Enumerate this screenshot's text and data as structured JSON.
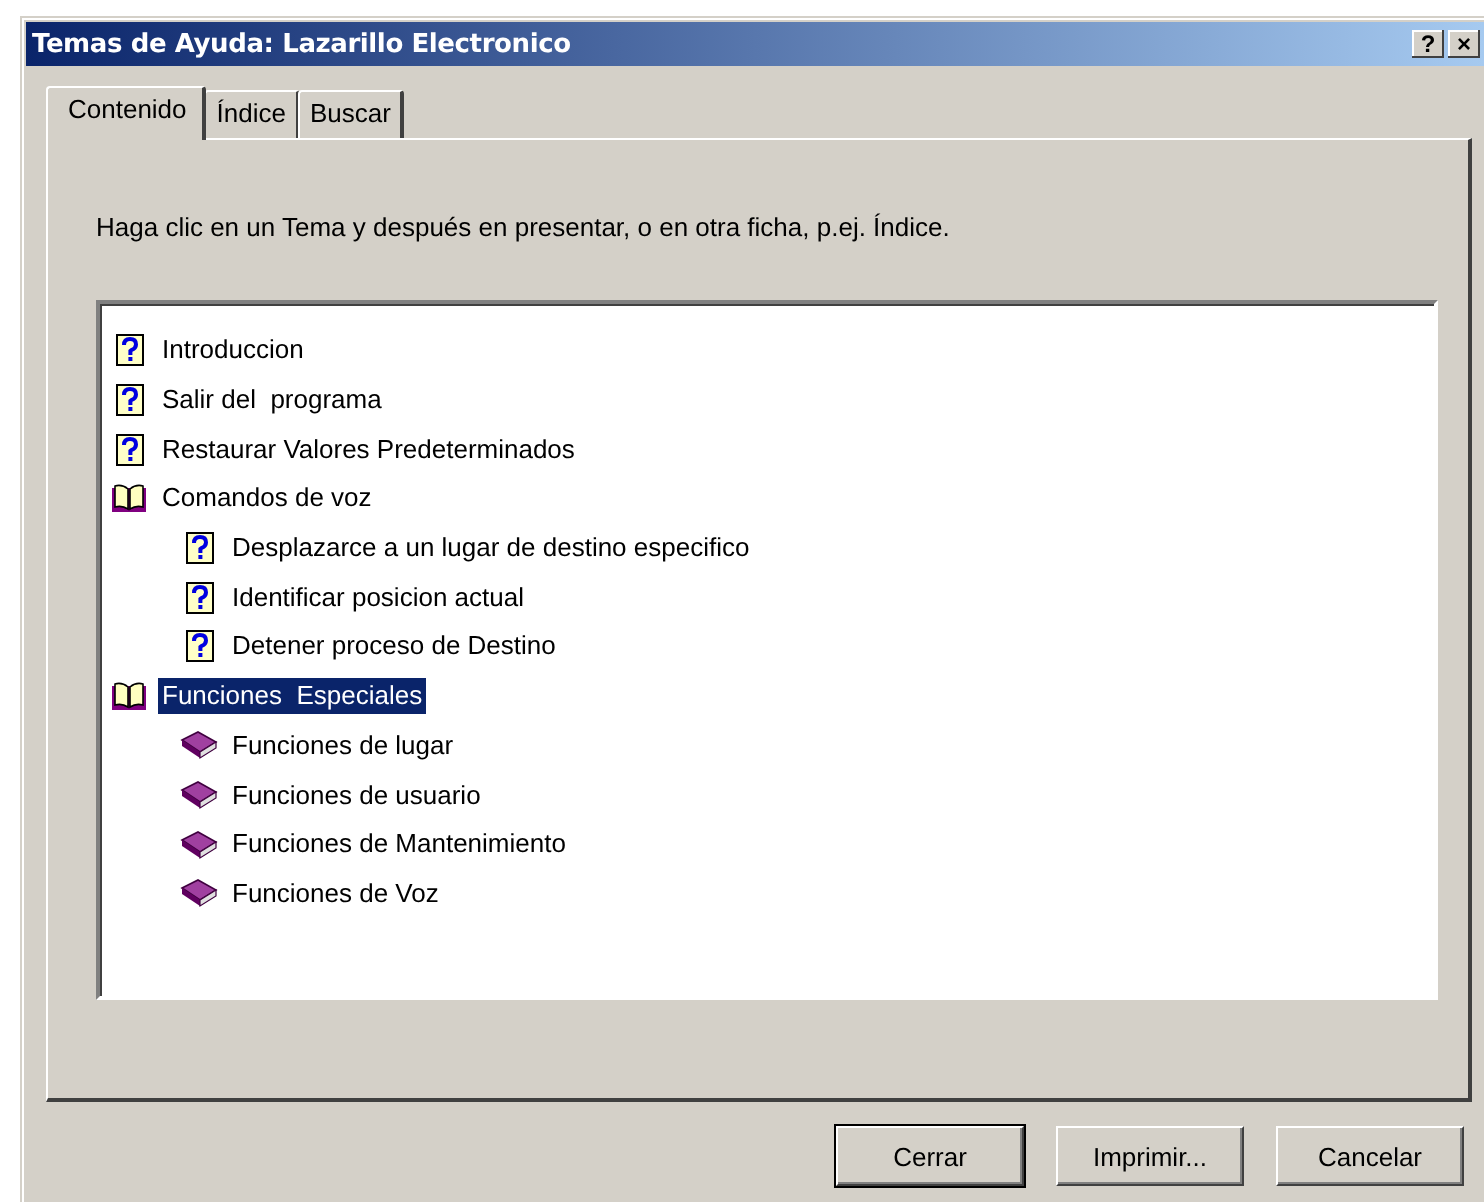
{
  "window": {
    "title": "Temas de Ayuda: Lazarillo Electronico",
    "help_button": "?",
    "close_button": "×"
  },
  "tabs": [
    {
      "label": "Contenido",
      "selected": true
    },
    {
      "label": "Índice",
      "selected": false
    },
    {
      "label": "Buscar",
      "selected": false
    }
  ],
  "instructions": "Haga clic en un Tema y después en presentar, o en otra ficha, p.ej. Índice.",
  "tree": [
    {
      "label": "Introduccion",
      "kind": "topic",
      "selected": false
    },
    {
      "label": "Salir del  programa",
      "kind": "topic",
      "selected": false
    },
    {
      "label": "Restaurar Valores Predeterminados",
      "kind": "topic",
      "selected": false
    },
    {
      "label": "Comandos de voz",
      "kind": "book",
      "expanded": true,
      "selected": false,
      "children": [
        {
          "label": "Desplazarce a un lugar de destino especifico",
          "kind": "topic",
          "selected": false
        },
        {
          "label": "Identificar posicion actual",
          "kind": "topic",
          "selected": false
        },
        {
          "label": "Detener proceso de Destino",
          "kind": "topic",
          "selected": false
        }
      ]
    },
    {
      "label": "Funciones  Especiales",
      "kind": "book",
      "expanded": true,
      "selected": true,
      "children": [
        {
          "label": "Funciones de lugar",
          "kind": "book",
          "expanded": false,
          "selected": false
        },
        {
          "label": "Funciones de usuario",
          "kind": "book",
          "expanded": false,
          "selected": false
        },
        {
          "label": "Funciones de Mantenimiento",
          "kind": "book",
          "expanded": false,
          "selected": false
        },
        {
          "label": "Funciones de Voz",
          "kind": "book",
          "expanded": false,
          "selected": false
        }
      ]
    }
  ],
  "buttons": [
    {
      "label": "Cerrar",
      "default": true
    },
    {
      "label": "Imprimir...",
      "default": false
    },
    {
      "label": "Cancelar",
      "default": false
    }
  ]
}
